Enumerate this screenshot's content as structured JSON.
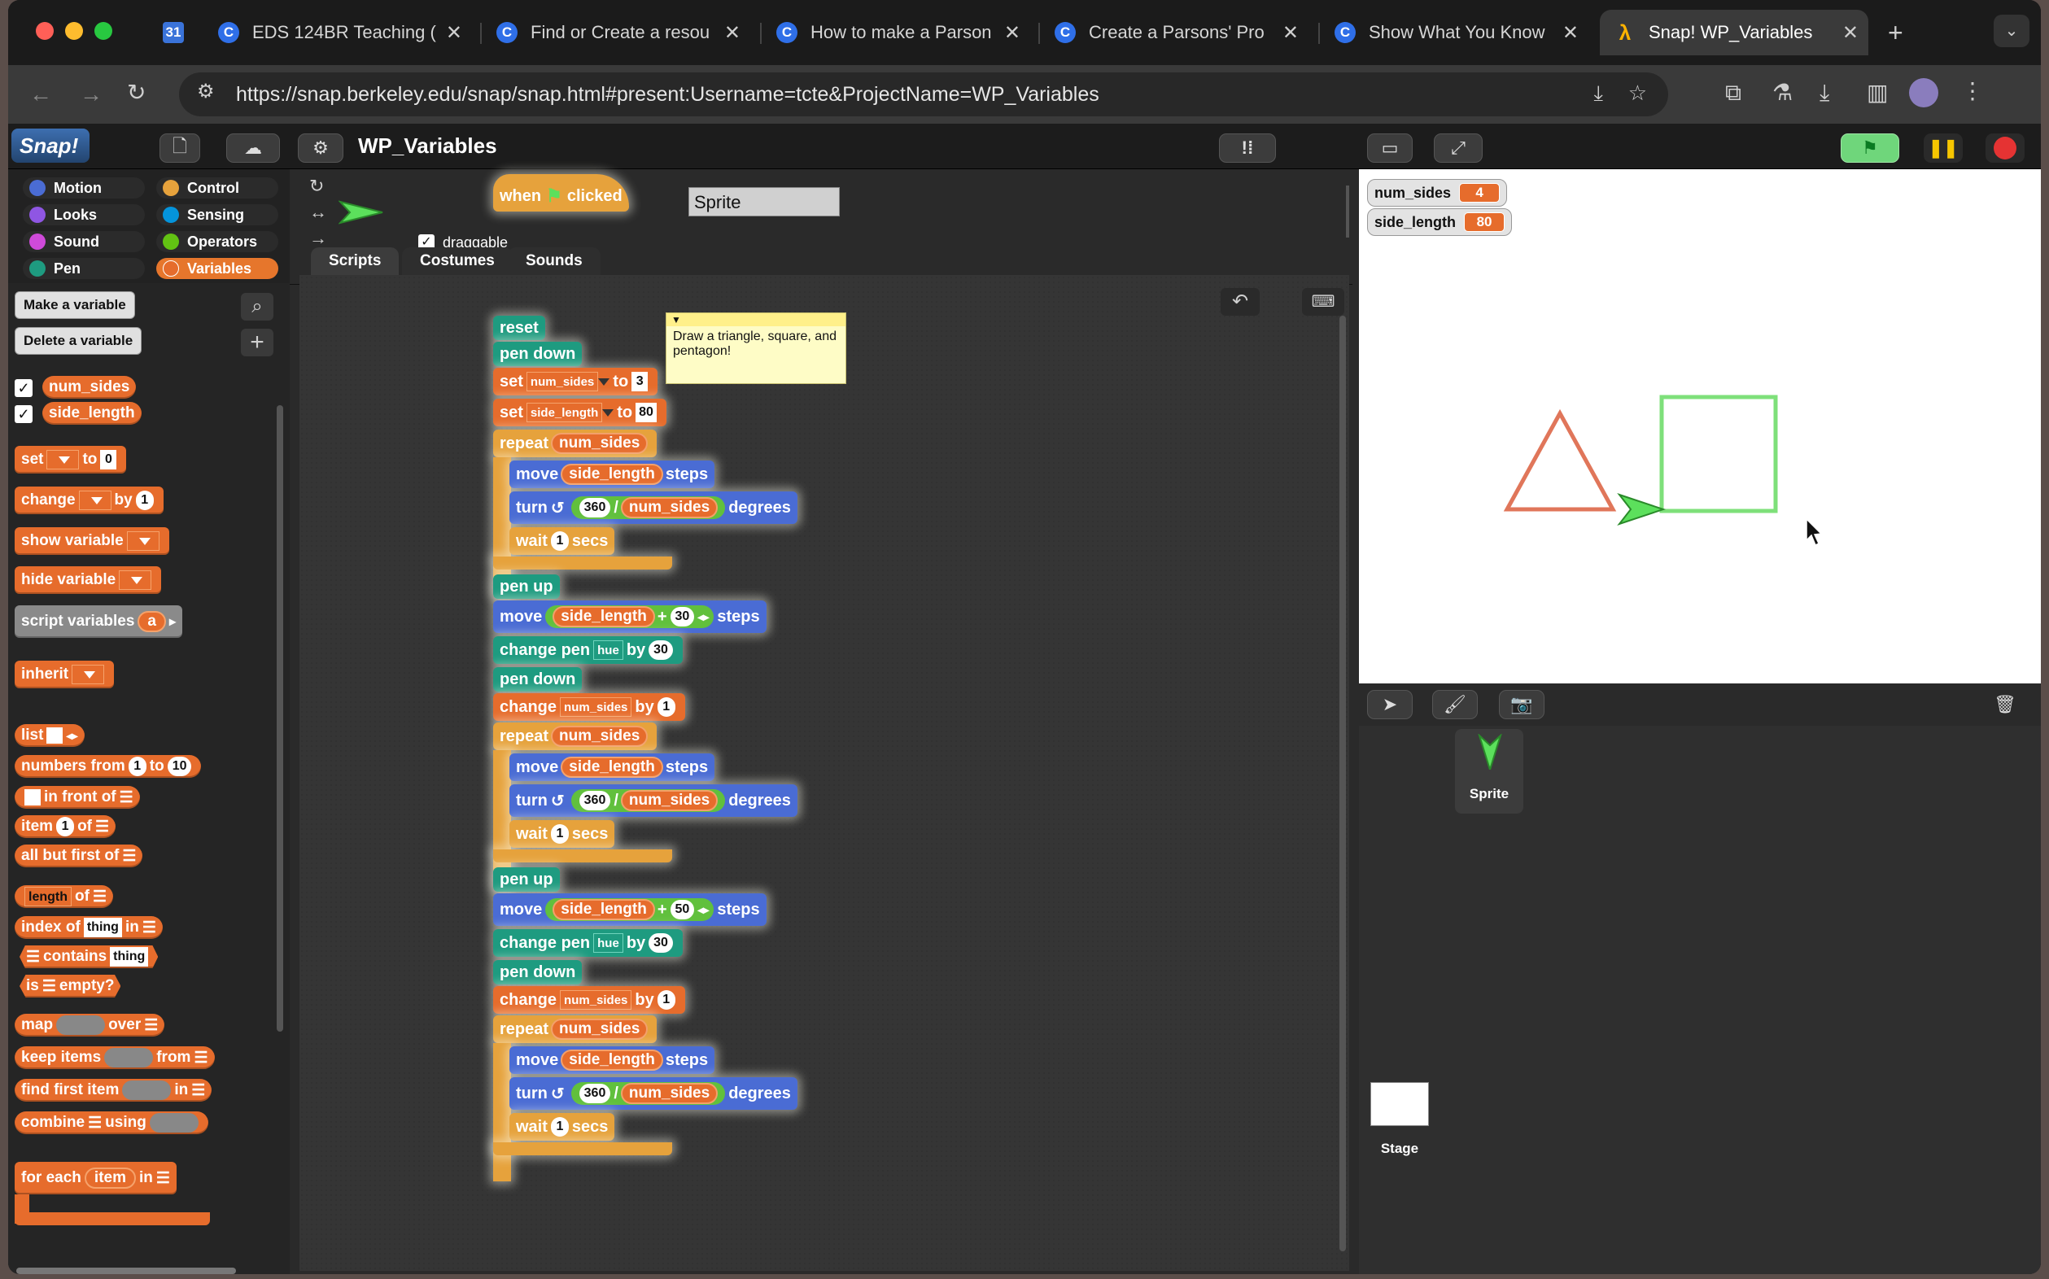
{
  "browser": {
    "tabs": [
      {
        "label": "",
        "icon": "calendar-icon"
      },
      {
        "label": "EDS 124BR Teaching ("
      },
      {
        "label": "Find or Create a resou"
      },
      {
        "label": "How to make a Parson"
      },
      {
        "label": "Create a Parsons' Pro"
      },
      {
        "label": "Show What You Know"
      },
      {
        "label": "Snap! WP_Variables"
      }
    ],
    "url": "https://snap.berkeley.edu/snap/snap.html#present:Username=tcte&ProjectName=WP_Variables",
    "new_tab": "+"
  },
  "snap": {
    "logo": "Snap!",
    "project_name": "WP_Variables",
    "categories": [
      {
        "label": "Motion",
        "color": "#4a6cd4"
      },
      {
        "label": "Control",
        "color": "#e6a23c"
      },
      {
        "label": "Looks",
        "color": "#8f56e3"
      },
      {
        "label": "Sensing",
        "color": "#0494dc"
      },
      {
        "label": "Sound",
        "color": "#cf4ad9"
      },
      {
        "label": "Operators",
        "color": "#62c213"
      },
      {
        "label": "Pen",
        "color": "#1e9b80"
      },
      {
        "label": "Variables",
        "color": "#e66c2c"
      }
    ],
    "palette": {
      "make_variable": "Make a variable",
      "delete_variable": "Delete a variable",
      "vars": [
        "num_sides",
        "side_length"
      ],
      "set": "set",
      "to": "to",
      "set_val": "0",
      "change": "change",
      "by": "by",
      "change_val": "1",
      "show_variable": "show variable",
      "hide_variable": "hide variable",
      "script_variables": "script variables",
      "script_var": "a",
      "inherit": "inherit",
      "list": "list",
      "numbers_from": "numbers from",
      "nf_a": "1",
      "nf_b": "10",
      "in_front_of": "in front of",
      "item": "item",
      "item_val": "1",
      "of": "of",
      "all_but_first": "all but first of",
      "length": "length",
      "index_of": "index of",
      "thing": "thing",
      "in": "in",
      "contains": "contains",
      "is_empty": "is",
      "empty": "empty?",
      "map": "map",
      "over": "over",
      "keep_items": "keep items",
      "from": "from",
      "find_first": "find first item",
      "combine": "combine",
      "using": "using",
      "for_each": "for each",
      "item_var": "item"
    },
    "sprite": {
      "name": "Sprite",
      "draggable": "draggable"
    },
    "tabs": [
      "Scripts",
      "Costumes",
      "Sounds"
    ],
    "script": {
      "when": "when",
      "clicked": "clicked",
      "reset": "reset",
      "pen_down": "pen down",
      "pen_up": "pen up",
      "set": "set",
      "to": "to",
      "num_sides": "num_sides",
      "side_length": "side_length",
      "set1": "3",
      "set2": "80",
      "repeat": "repeat",
      "move": "move",
      "steps": "steps",
      "turn": "turn",
      "degrees": "degrees",
      "deg": "360",
      "slash": "/",
      "wait": "wait",
      "secs": "secs",
      "wait_val": "1",
      "plus": "+",
      "add1": "30",
      "add2": "50",
      "change_pen": "change pen",
      "hue": "hue",
      "by": "by",
      "hue_val": "30",
      "change": "change",
      "change_val": "1"
    },
    "comment": "Draw a triangle, square, and pentagon!",
    "watchers": [
      {
        "name": "num_sides",
        "value": "4"
      },
      {
        "name": "side_length",
        "value": "80"
      }
    ],
    "corral": {
      "sprite": "Sprite",
      "stage": "Stage"
    },
    "colors": {
      "variables": "#e66c2c",
      "control": "#e6a23c",
      "pen": "#1e9b80",
      "motion": "#4a6cd4",
      "operators": "#61c03d",
      "triangle": "#e0765a",
      "square": "#7ee07a"
    }
  }
}
